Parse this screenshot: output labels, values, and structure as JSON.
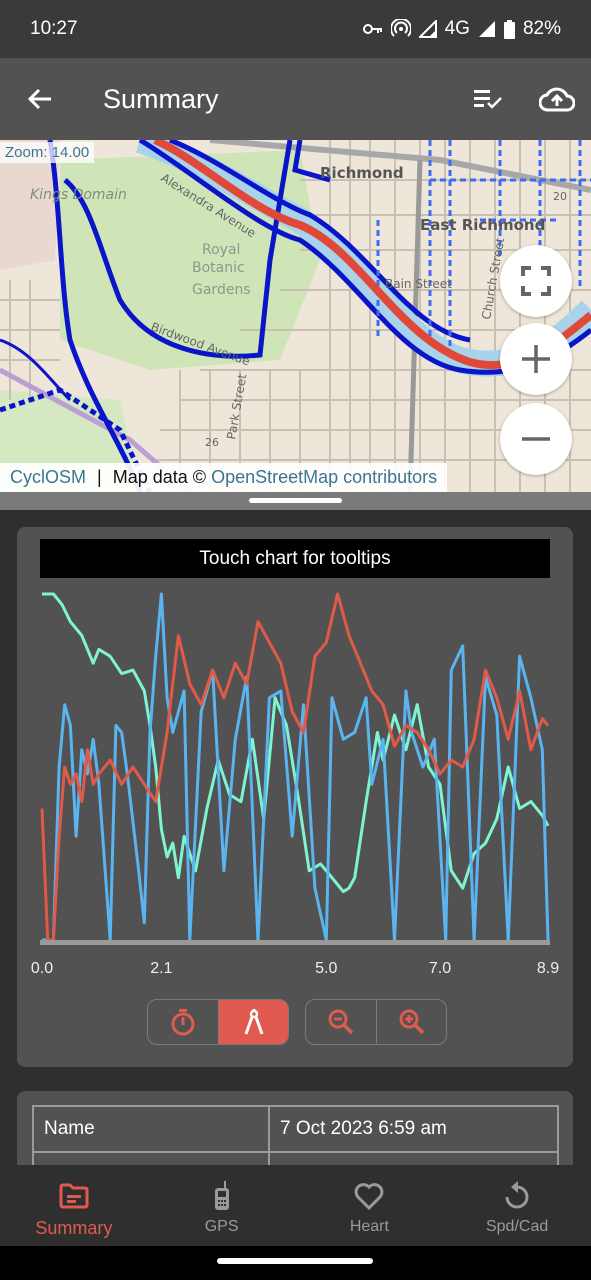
{
  "status_bar": {
    "time": "10:27",
    "network": "4G",
    "battery": "82%",
    "icons": [
      "vpn-key-icon",
      "hotspot-icon",
      "signal-icon",
      "signal-icon",
      "battery-icon"
    ]
  },
  "app_bar": {
    "title": "Summary",
    "back_icon": "arrow-left-icon",
    "actions": [
      {
        "name": "checklist-icon"
      },
      {
        "name": "cloud-upload-icon"
      }
    ]
  },
  "map": {
    "zoom_label": "Zoom: 14.00",
    "place_labels": [
      "Richmond",
      "East Richmond",
      "Kings Domain",
      "Royal Botanic Gardens",
      "Alexandra Avenue",
      "Birdwood Avenue",
      "Park Street",
      "Bain Street",
      "Church Street"
    ],
    "attribution": {
      "provider": "CyclOSM",
      "separator": "|",
      "text": "Map data ©",
      "link": "OpenStreetMap contributors"
    },
    "colors": {
      "route": "#e0483a",
      "cycleway": "#0a14c8",
      "river": "#a9d3ea",
      "park": "#cfe5b8",
      "land": "#eee6d9"
    }
  },
  "chart": {
    "header": "Touch chart for tooltips"
  },
  "chart_data": {
    "type": "line",
    "title": "Touch chart for tooltips",
    "xlabel": "",
    "ylabel": "",
    "x_ticks": [
      "0.0",
      "2.1",
      "5.0",
      "7.0",
      "8.9"
    ],
    "xlim": [
      0.0,
      8.9
    ],
    "ylim": [
      0,
      100
    ],
    "grid": false,
    "series": [
      {
        "name": "teal-series",
        "color": "#7ef5d0",
        "x": [
          0.0,
          0.2,
          0.35,
          0.5,
          0.7,
          0.9,
          1.0,
          1.2,
          1.4,
          1.6,
          1.8,
          1.9,
          2.0,
          2.1,
          2.2,
          2.3,
          2.4,
          2.5,
          2.7,
          2.9,
          3.1,
          3.3,
          3.5,
          3.7,
          3.9,
          4.1,
          4.3,
          4.5,
          4.7,
          4.9,
          5.1,
          5.3,
          5.4,
          5.5,
          5.7,
          5.9,
          6.0,
          6.2,
          6.4,
          6.6,
          6.8,
          7.0,
          7.2,
          7.4,
          7.6,
          7.8,
          8.0,
          8.2,
          8.4,
          8.6,
          8.8,
          8.9
        ],
        "values": [
          100,
          100,
          97,
          92,
          88,
          80,
          84,
          82,
          77,
          78,
          72,
          62,
          50,
          32,
          24,
          28,
          18,
          30,
          20,
          38,
          52,
          42,
          40,
          58,
          35,
          70,
          62,
          42,
          20,
          22,
          18,
          14,
          15,
          18,
          40,
          60,
          52,
          65,
          55,
          68,
          50,
          45,
          20,
          15,
          25,
          28,
          35,
          50,
          38,
          40,
          36,
          33
        ]
      },
      {
        "name": "blue-series",
        "color": "#5ab4f0",
        "x": [
          0.0,
          0.2,
          0.3,
          0.4,
          0.5,
          0.6,
          0.7,
          0.8,
          0.9,
          1.0,
          1.2,
          1.3,
          1.4,
          1.5,
          1.7,
          1.8,
          1.9,
          2.0,
          2.1,
          2.2,
          2.3,
          2.5,
          2.6,
          2.8,
          3.0,
          3.2,
          3.4,
          3.6,
          3.8,
          4.0,
          4.2,
          4.4,
          4.6,
          4.8,
          5.0,
          5.1,
          5.3,
          5.5,
          5.7,
          5.8,
          6.0,
          6.2,
          6.4,
          6.5,
          6.7,
          6.9,
          7.1,
          7.2,
          7.4,
          7.6,
          7.8,
          8.0,
          8.2,
          8.4,
          8.6,
          8.8,
          8.9
        ],
        "values": [
          0,
          0,
          50,
          68,
          62,
          30,
          55,
          48,
          58,
          45,
          0,
          62,
          60,
          48,
          20,
          5,
          60,
          82,
          100,
          70,
          60,
          72,
          0,
          66,
          78,
          20,
          58,
          76,
          0,
          70,
          72,
          30,
          68,
          15,
          0,
          70,
          58,
          60,
          70,
          45,
          58,
          0,
          72,
          60,
          50,
          58,
          0,
          78,
          85,
          0,
          76,
          65,
          0,
          82,
          70,
          55,
          0
        ]
      },
      {
        "name": "red-series",
        "color": "#e05a48",
        "x": [
          0.0,
          0.1,
          0.2,
          0.3,
          0.4,
          0.5,
          0.6,
          0.7,
          0.8,
          0.9,
          1.0,
          1.2,
          1.4,
          1.6,
          1.8,
          2.0,
          2.2,
          2.4,
          2.6,
          2.8,
          3.0,
          3.2,
          3.4,
          3.6,
          3.8,
          4.0,
          4.2,
          4.4,
          4.6,
          4.8,
          5.0,
          5.2,
          5.4,
          5.6,
          5.8,
          6.0,
          6.2,
          6.4,
          6.6,
          6.8,
          7.0,
          7.2,
          7.4,
          7.6,
          7.8,
          8.0,
          8.2,
          8.4,
          8.6,
          8.8,
          8.9
        ],
        "values": [
          38,
          0,
          0,
          30,
          50,
          45,
          48,
          40,
          55,
          45,
          48,
          52,
          45,
          50,
          45,
          40,
          60,
          88,
          74,
          68,
          78,
          70,
          80,
          74,
          92,
          86,
          80,
          66,
          60,
          82,
          86,
          100,
          88,
          80,
          72,
          68,
          56,
          62,
          60,
          55,
          48,
          52,
          50,
          58,
          78,
          70,
          58,
          72,
          55,
          64,
          62
        ]
      }
    ]
  },
  "chart_controls": {
    "mode_buttons": [
      {
        "name": "stopwatch-icon",
        "active": false
      },
      {
        "name": "compass-divider-icon",
        "active": true
      }
    ],
    "zoom_buttons": [
      {
        "name": "zoom-out-icon"
      },
      {
        "name": "zoom-in-icon"
      }
    ]
  },
  "summary_table": {
    "rows": [
      {
        "key": "Name",
        "value": "7 Oct 2023 6:59 am"
      },
      {
        "key": "",
        "value": ""
      }
    ]
  },
  "bottom_nav": {
    "items": [
      {
        "label": "Summary",
        "icon": "folder-icon",
        "active": true
      },
      {
        "label": "GPS",
        "icon": "phone-gps-icon",
        "active": false
      },
      {
        "label": "Heart",
        "icon": "heart-icon",
        "active": false
      },
      {
        "label": "Spd/Cad",
        "icon": "refresh-icon",
        "active": false
      }
    ]
  },
  "colors": {
    "accent": "#e05a50",
    "appbar": "#525252",
    "background": "#2f2f2f",
    "card": "#525252"
  }
}
